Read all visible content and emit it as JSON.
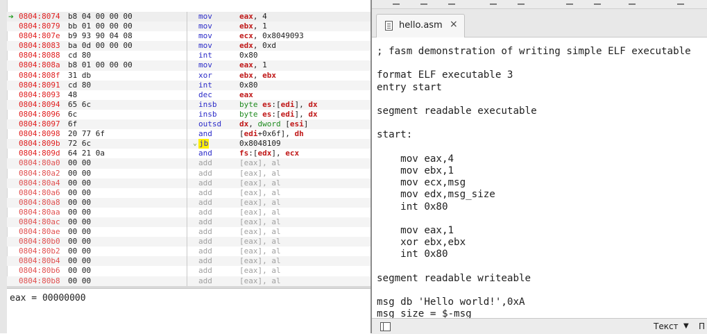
{
  "disassembly": {
    "rows": [
      {
        "addr": "0804:8074",
        "bytes": "b8 04 00 00 00",
        "mnem": "mov",
        "ops": [
          {
            "t": "eax",
            "c": "reg"
          },
          {
            "t": ", 4"
          }
        ],
        "current": true
      },
      {
        "addr": "0804:8079",
        "bytes": "bb 01 00 00 00",
        "mnem": "mov",
        "ops": [
          {
            "t": "ebx",
            "c": "reg"
          },
          {
            "t": ", 1"
          }
        ]
      },
      {
        "addr": "0804:807e",
        "bytes": "b9 93 90 04 08",
        "mnem": "mov",
        "ops": [
          {
            "t": "ecx",
            "c": "reg"
          },
          {
            "t": ", 0x8049093"
          }
        ]
      },
      {
        "addr": "0804:8083",
        "bytes": "ba 0d 00 00 00",
        "mnem": "mov",
        "ops": [
          {
            "t": "edx",
            "c": "reg"
          },
          {
            "t": ", 0xd"
          }
        ]
      },
      {
        "addr": "0804:8088",
        "bytes": "cd 80",
        "mnem": "int",
        "ops": [
          {
            "t": "0x80"
          }
        ]
      },
      {
        "addr": "0804:808a",
        "bytes": "b8 01 00 00 00",
        "mnem": "mov",
        "ops": [
          {
            "t": "eax",
            "c": "reg"
          },
          {
            "t": ", 1"
          }
        ]
      },
      {
        "addr": "0804:808f",
        "bytes": "31 db",
        "mnem": "xor",
        "ops": [
          {
            "t": "ebx",
            "c": "reg"
          },
          {
            "t": ", "
          },
          {
            "t": "ebx",
            "c": "reg"
          }
        ]
      },
      {
        "addr": "0804:8091",
        "bytes": "cd 80",
        "mnem": "int",
        "ops": [
          {
            "t": "0x80"
          }
        ]
      },
      {
        "addr": "0804:8093",
        "bytes": "48",
        "mnem": "dec",
        "ops": [
          {
            "t": "eax",
            "c": "reg"
          }
        ]
      },
      {
        "addr": "0804:8094",
        "bytes": "65 6c",
        "mnem": "insb",
        "ops": [
          {
            "t": "byte ",
            "c": "kw"
          },
          {
            "t": "es",
            "c": "reg"
          },
          {
            "t": ":["
          },
          {
            "t": "edi",
            "c": "reg"
          },
          {
            "t": "], "
          },
          {
            "t": "dx",
            "c": "reg"
          }
        ]
      },
      {
        "addr": "0804:8096",
        "bytes": "6c",
        "mnem": "insb",
        "ops": [
          {
            "t": "byte ",
            "c": "kw"
          },
          {
            "t": "es",
            "c": "reg"
          },
          {
            "t": ":["
          },
          {
            "t": "edi",
            "c": "reg"
          },
          {
            "t": "], "
          },
          {
            "t": "dx",
            "c": "reg"
          }
        ]
      },
      {
        "addr": "0804:8097",
        "bytes": "6f",
        "mnem": "outsd",
        "ops": [
          {
            "t": "dx",
            "c": "reg"
          },
          {
            "t": ", "
          },
          {
            "t": "dword ",
            "c": "kw"
          },
          {
            "t": "["
          },
          {
            "t": "esi",
            "c": "reg"
          },
          {
            "t": "]"
          }
        ]
      },
      {
        "addr": "0804:8098",
        "bytes": "20 77 6f",
        "mnem": "and",
        "ops": [
          {
            "t": "["
          },
          {
            "t": "edi",
            "c": "reg"
          },
          {
            "t": "+0x6f], "
          },
          {
            "t": "dh",
            "c": "reg"
          }
        ]
      },
      {
        "addr": "0804:809b",
        "bytes": "72 6c",
        "mnem": "jb",
        "ops": [
          {
            "t": "0x8048109"
          }
        ],
        "highlight": true
      },
      {
        "addr": "0804:809d",
        "bytes": "64 21 0a",
        "mnem": "and",
        "ops": [
          {
            "t": "fs",
            "c": "reg"
          },
          {
            "t": ":["
          },
          {
            "t": "edx",
            "c": "reg"
          },
          {
            "t": "], "
          },
          {
            "t": "ecx",
            "c": "reg"
          }
        ]
      },
      {
        "addr": "0804:80a0",
        "bytes": "00 00",
        "mnem": "add",
        "ops": [
          {
            "t": "[eax], al"
          }
        ],
        "faded": true
      },
      {
        "addr": "0804:80a2",
        "bytes": "00 00",
        "mnem": "add",
        "ops": [
          {
            "t": "[eax], al"
          }
        ],
        "faded": true
      },
      {
        "addr": "0804:80a4",
        "bytes": "00 00",
        "mnem": "add",
        "ops": [
          {
            "t": "[eax], al"
          }
        ],
        "faded": true
      },
      {
        "addr": "0804:80a6",
        "bytes": "00 00",
        "mnem": "add",
        "ops": [
          {
            "t": "[eax], al"
          }
        ],
        "faded": true
      },
      {
        "addr": "0804:80a8",
        "bytes": "00 00",
        "mnem": "add",
        "ops": [
          {
            "t": "[eax], al"
          }
        ],
        "faded": true
      },
      {
        "addr": "0804:80aa",
        "bytes": "00 00",
        "mnem": "add",
        "ops": [
          {
            "t": "[eax], al"
          }
        ],
        "faded": true
      },
      {
        "addr": "0804:80ac",
        "bytes": "00 00",
        "mnem": "add",
        "ops": [
          {
            "t": "[eax], al"
          }
        ],
        "faded": true
      },
      {
        "addr": "0804:80ae",
        "bytes": "00 00",
        "mnem": "add",
        "ops": [
          {
            "t": "[eax], al"
          }
        ],
        "faded": true
      },
      {
        "addr": "0804:80b0",
        "bytes": "00 00",
        "mnem": "add",
        "ops": [
          {
            "t": "[eax], al"
          }
        ],
        "faded": true
      },
      {
        "addr": "0804:80b2",
        "bytes": "00 00",
        "mnem": "add",
        "ops": [
          {
            "t": "[eax], al"
          }
        ],
        "faded": true
      },
      {
        "addr": "0804:80b4",
        "bytes": "00 00",
        "mnem": "add",
        "ops": [
          {
            "t": "[eax], al"
          }
        ],
        "faded": true
      },
      {
        "addr": "0804:80b6",
        "bytes": "00 00",
        "mnem": "add",
        "ops": [
          {
            "t": "[eax], al"
          }
        ],
        "faded": true
      },
      {
        "addr": "0804:80b8",
        "bytes": "00 00",
        "mnem": "add",
        "ops": [
          {
            "t": "[eax], al"
          }
        ],
        "faded": true
      }
    ]
  },
  "registers": {
    "line": "eax = 00000000"
  },
  "editor": {
    "tab": {
      "label": "hello.asm",
      "close": "×",
      "icon": "document-icon"
    },
    "lines": [
      "; fasm demonstration of writing simple ELF executable",
      "",
      "format ELF executable 3",
      "entry start",
      "",
      "segment readable executable",
      "",
      "start:",
      "",
      "    mov eax,4",
      "    mov ebx,1",
      "    mov ecx,msg",
      "    mov edx,msg_size",
      "    int 0x80",
      "",
      "    mov eax,1",
      "    xor ebx,ebx",
      "    int 0x80",
      "",
      "segment readable writeable",
      "",
      "msg db 'Hello world!',0xA",
      "msg_size = $-msg"
    ]
  },
  "statusbar": {
    "language": "Текст",
    "arrow": "▼",
    "extra": "П"
  }
}
